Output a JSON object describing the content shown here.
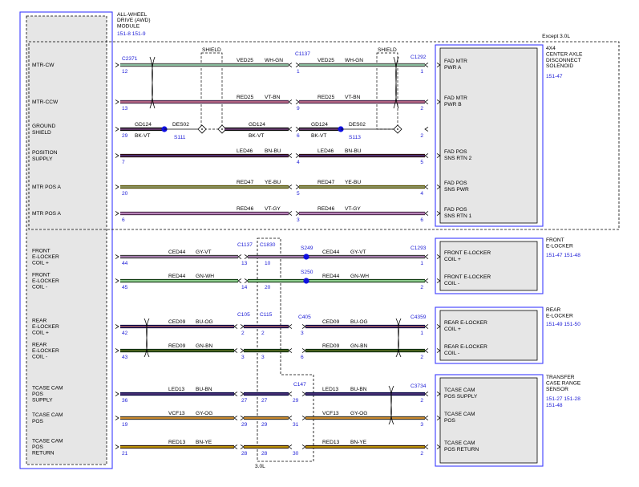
{
  "module": {
    "title": [
      "ALL-WHEEL",
      "DRIVE (AWD)",
      "MODULE"
    ],
    "refs": [
      "151-8",
      "151-9"
    ]
  },
  "except_note": "Except 3.0L",
  "engine_note": "3.0L",
  "shield_label": "SHIELD",
  "pins": [
    {
      "label": [
        "MTR-CW"
      ],
      "pin": "12"
    },
    {
      "label": [
        "MTR-CCW"
      ],
      "pin": "13"
    },
    {
      "label": [
        "GROUND",
        "SHIELD"
      ],
      "pin": "29"
    },
    {
      "label": [
        "POSITION",
        "SUPPLY"
      ],
      "pin": "7"
    },
    {
      "label": [
        "MTR POS A"
      ],
      "pin": "20"
    },
    {
      "label": [
        "MTR POS A"
      ],
      "pin": "6"
    },
    {
      "label": [
        "FRONT",
        "E-LOCKER",
        "COIL +"
      ],
      "pin": "44"
    },
    {
      "label": [
        "FRONT",
        "E-LOCKER",
        "COIL -"
      ],
      "pin": "45"
    },
    {
      "label": [
        "REAR",
        "E-LOCKER",
        "COIL +"
      ],
      "pin": "42"
    },
    {
      "label": [
        "REAR",
        "E-LOCKER",
        "COIL -"
      ],
      "pin": "43"
    },
    {
      "label": [
        "TCASE CAM",
        "POS",
        "SUPPLY"
      ],
      "pin": "36"
    },
    {
      "label": [
        "TCASE CAM",
        "POS"
      ],
      "pin": "19"
    },
    {
      "label": [
        "TCASE CAM",
        "POS",
        "RETURN"
      ],
      "pin": "21"
    }
  ],
  "module_connector": "C2371",
  "wires": [
    {
      "circuit": "VED25",
      "color": "WH-GN",
      "hex": "#e6f0e6",
      "stripe": "#2e8b57"
    },
    {
      "circuit": "RED25",
      "color": "VT-BN",
      "hex": "#d86fd8",
      "stripe": "#8b5a2b"
    },
    {
      "circuit": "GD124",
      "color": "BK-VT",
      "hex": "#111111",
      "stripe": "#b060c0"
    },
    {
      "circuit": "LED46",
      "color": "BN-BU",
      "hex": "#7a1f1f",
      "stripe": "#2040c0"
    },
    {
      "circuit": "RED47",
      "color": "YE-BU",
      "hex": "#f2e200",
      "stripe": "#2040c0"
    },
    {
      "circuit": "RED46",
      "color": "VT-GY",
      "hex": "#d86fd8",
      "stripe": "#999999"
    },
    {
      "circuit": "CED44",
      "color": "GY-VT",
      "hex": "#9a9a9a",
      "stripe": "#b060c0"
    },
    {
      "circuit": "RED44",
      "color": "GN-WH",
      "hex": "#1f9a1f",
      "stripe": "#ffffff"
    },
    {
      "circuit": "CED09",
      "color": "BU-OG",
      "hex": "#1010c0",
      "stripe": "#ff8c00"
    },
    {
      "circuit": "RED09",
      "color": "GN-BN",
      "hex": "#1f7a1f",
      "stripe": "#7a4a1f"
    },
    {
      "circuit": "LED13",
      "color": "BU-BN",
      "hex": "#1010c0",
      "stripe": "#7a4a1f"
    },
    {
      "circuit": "VCF13",
      "color": "GY-OG",
      "hex": "#9a8a60",
      "stripe": "#ff8c00"
    },
    {
      "circuit": "RED13",
      "color": "BN-YE",
      "hex": "#8b4513",
      "stripe": "#f2e200"
    }
  ],
  "awd_connectors": [
    {
      "name": "C1137",
      "pins": [
        "1",
        "9",
        "6",
        "4",
        "5",
        "3"
      ]
    },
    {
      "name": "C1292",
      "pins": [
        "1",
        "2",
        "2",
        "5",
        "4",
        "6"
      ]
    }
  ],
  "ground_splice": {
    "shield_circuit": "GD124",
    "splice_wire": "DES02",
    "color": "BK-VT",
    "splices": [
      "S111",
      "S113"
    ]
  },
  "front": {
    "connectors": [
      "C1137",
      "C1830",
      "C1293"
    ],
    "pins_left": [
      "13",
      "14"
    ],
    "pins_mid": [
      "10",
      "20"
    ],
    "pins_right": [
      "1",
      "2"
    ],
    "splices": [
      "S249",
      "S250"
    ]
  },
  "rear": {
    "connectors": [
      "C105",
      "C115",
      "C405",
      "C4359"
    ],
    "pins_left": [
      "2",
      "3"
    ],
    "pins_mid": [
      "2",
      "3"
    ],
    "pins_c405": [
      "3",
      "6"
    ],
    "pins_right": [
      "1",
      "2"
    ]
  },
  "tcase": {
    "connectors": [
      "C147",
      "C3734"
    ],
    "pins_c105": [
      "27",
      "29",
      "28"
    ],
    "pins_c115": [
      "27",
      "29",
      "28"
    ],
    "pins_c147": [
      "29",
      "31",
      "30"
    ],
    "pins_right": [
      "2",
      "3",
      "2"
    ]
  },
  "components": [
    {
      "title": [
        "4X4",
        "CENTER AXLE",
        "DISCONNECT",
        "SOLENOID"
      ],
      "refs": [
        "151-47"
      ],
      "pins": [
        [
          "FAD MTR",
          "PWR A"
        ],
        [
          "FAD MTR",
          "PWR B"
        ],
        [
          "FAD POS",
          "SNS RTN 2"
        ],
        [
          "FAD POS",
          "SNS PWR"
        ],
        [
          "FAD POS",
          "SNS RTN 1"
        ]
      ]
    },
    {
      "title": [
        "FRONT",
        "E-LOCKER"
      ],
      "refs": [
        "151-47",
        "151-48"
      ],
      "pins": [
        [
          "FRONT E-LOCKER",
          "COIL +"
        ],
        [
          "FRONT E-LOCKER",
          "COIL -"
        ]
      ]
    },
    {
      "title": [
        "REAR",
        "E-LOCKER"
      ],
      "refs": [
        "151-49",
        "151-50"
      ],
      "pins": [
        [
          "REAR E-LOCKER",
          "COIL +"
        ],
        [
          "REAR E-LOCKER",
          "COIL -"
        ]
      ]
    },
    {
      "title": [
        "TRANSFER",
        "CASE RANGE",
        "SENSOR"
      ],
      "refs": [
        "151-27",
        "151-28",
        "151-48"
      ],
      "pins": [
        [
          "TCASE CAM",
          "POS SUPPLY"
        ],
        [
          "TCASE CAM",
          "POS"
        ],
        [
          "TCASE CAM",
          "POS RETURN"
        ]
      ]
    }
  ]
}
